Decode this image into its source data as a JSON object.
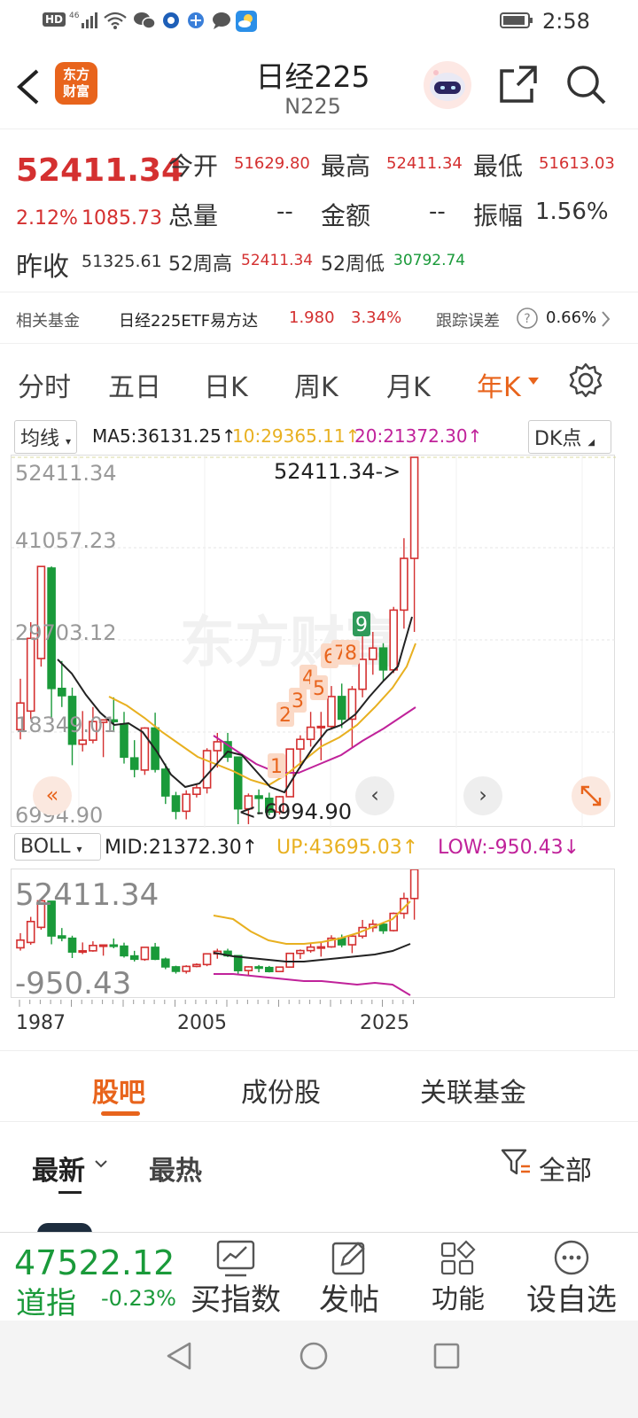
{
  "status": {
    "time": "2:58"
  },
  "header": {
    "title": "日经225",
    "code": "N225",
    "logo_line1": "东方",
    "logo_line2": "财富"
  },
  "quote": {
    "price": "52411.34",
    "change_pct": "2.12%",
    "change": "1085.73",
    "open_label": "今开",
    "open": "51629.80",
    "high_label": "最高",
    "high": "52411.34",
    "low_label": "最低",
    "low": "51613.03",
    "volume_label": "总量",
    "volume": "--",
    "amount_label": "金额",
    "amount": "--",
    "amplitude_label": "振幅",
    "amplitude": "1.56%",
    "prev_close_label": "昨收",
    "prev_close": "51325.61",
    "w52_high_label": "52周高",
    "w52_high": "52411.34",
    "w52_low_label": "52周低",
    "w52_low": "30792.74"
  },
  "fund": {
    "label": "相关基金",
    "name": "日经225ETF易方达",
    "price": "1.980",
    "pct": "3.34%",
    "err_label": "跟踪误差",
    "err": "0.66%"
  },
  "period_tabs": [
    "分时",
    "五日",
    "日K",
    "周K",
    "月K",
    "年K"
  ],
  "active_period": "年K",
  "ma_legend": {
    "selector": "均线",
    "ma5": "MA5:36131.25↑",
    "ma10": "10:29365.11↑",
    "ma20": "20:21372.30↑",
    "dk": "DK点"
  },
  "chart_labels": {
    "y_top": "52411.34",
    "y_2": "41057.23",
    "y_3": "29703.12",
    "y_4": "18349.01",
    "y_bottom": "6994.90",
    "high_marker": "52411.34->",
    "low_marker": "<-6994.90",
    "watermark": "东方财富"
  },
  "boll_legend": {
    "selector": "BOLL",
    "mid": "MID:21372.30↑",
    "up": "UP:43695.03↑",
    "low": "LOW:-950.43↓",
    "y_top": "52411.34",
    "y_bottom": "-950.43"
  },
  "x_axis": [
    "1987",
    "2005",
    "2025"
  ],
  "sub_tabs": [
    "股吧",
    "成份股",
    "关联基金"
  ],
  "sort_tabs": {
    "latest": "最新",
    "hot": "最热",
    "filter": "全部"
  },
  "bottom": {
    "index_value": "47522.12",
    "index_name": "道指",
    "index_pct": "-0.23%",
    "buy": "买指数",
    "post": "发帖",
    "func": "功能",
    "watch": "设自选"
  },
  "colors": {
    "up": "#d43030",
    "down": "#1a9a3a",
    "ma5": "#222222",
    "ma10": "#e8b020",
    "ma20": "#c0229a",
    "accent": "#e8641c"
  },
  "chart_data": {
    "type": "candlestick",
    "title": "",
    "x_labels": [
      "1987",
      "2005",
      "2025"
    ],
    "ylim": [
      6994.9,
      52411.34
    ],
    "tick_labels": [
      "52411.34",
      "41057.23",
      "29703.12",
      "18349.01",
      "6994.90"
    ],
    "candles": [
      {
        "o": 18700,
        "c": 22000,
        "h": 25000,
        "l": 17500
      },
      {
        "o": 21000,
        "c": 30000,
        "h": 32000,
        "l": 20000
      },
      {
        "o": 27500,
        "c": 38900,
        "h": 38900,
        "l": 26500
      },
      {
        "o": 38700,
        "c": 23800,
        "h": 38900,
        "l": 20200
      },
      {
        "o": 23800,
        "c": 22900,
        "h": 27200,
        "l": 21500
      },
      {
        "o": 22800,
        "c": 16900,
        "h": 23900,
        "l": 14300
      },
      {
        "o": 16900,
        "c": 17400,
        "h": 21000,
        "l": 16000
      },
      {
        "o": 17400,
        "c": 19700,
        "h": 21500,
        "l": 17000
      },
      {
        "o": 19600,
        "c": 19900,
        "h": 20000,
        "l": 15300
      },
      {
        "o": 19900,
        "c": 19700,
        "h": 22700,
        "l": 18500
      },
      {
        "o": 19400,
        "c": 15300,
        "h": 20900,
        "l": 14500
      },
      {
        "o": 15200,
        "c": 13800,
        "h": 17400,
        "l": 12800
      },
      {
        "o": 13700,
        "c": 18900,
        "h": 19000,
        "l": 13100
      },
      {
        "o": 18900,
        "c": 13800,
        "h": 20800,
        "l": 13400
      },
      {
        "o": 13800,
        "c": 10500,
        "h": 14500,
        "l": 9500
      },
      {
        "o": 10500,
        "c": 8600,
        "h": 11000,
        "l": 7600
      },
      {
        "o": 8600,
        "c": 10700,
        "h": 11200,
        "l": 7600
      },
      {
        "o": 10700,
        "c": 11500,
        "h": 12000,
        "l": 10300
      },
      {
        "o": 11500,
        "c": 16100,
        "h": 16400,
        "l": 10800
      },
      {
        "o": 16100,
        "c": 17200,
        "h": 18300,
        "l": 14000
      },
      {
        "o": 17200,
        "c": 15300,
        "h": 18300,
        "l": 14700
      },
      {
        "o": 15300,
        "c": 8900,
        "h": 15200,
        "l": 6994.9
      },
      {
        "o": 8900,
        "c": 10500,
        "h": 10800,
        "l": 7000
      },
      {
        "o": 10500,
        "c": 10200,
        "h": 11300,
        "l": 8200
      },
      {
        "o": 10200,
        "c": 8500,
        "h": 10900,
        "l": 8100
      },
      {
        "o": 8500,
        "c": 10400,
        "h": 10500,
        "l": 8200
      },
      {
        "o": 10400,
        "c": 16300,
        "h": 16300,
        "l": 10400
      },
      {
        "o": 16300,
        "c": 17500,
        "h": 18000,
        "l": 13900
      },
      {
        "o": 17500,
        "c": 19000,
        "h": 20900,
        "l": 16600
      },
      {
        "o": 19000,
        "c": 19100,
        "h": 20900,
        "l": 14900
      },
      {
        "o": 19100,
        "c": 22800,
        "h": 24100,
        "l": 18700
      },
      {
        "o": 22800,
        "c": 20000,
        "h": 24400,
        "l": 18900
      },
      {
        "o": 20000,
        "c": 23700,
        "h": 24100,
        "l": 16400
      },
      {
        "o": 23700,
        "c": 27400,
        "h": 30700,
        "l": 22700
      },
      {
        "o": 27400,
        "c": 28800,
        "h": 30800,
        "l": 25500
      },
      {
        "o": 28800,
        "c": 26100,
        "h": 29400,
        "l": 24700
      },
      {
        "o": 26100,
        "c": 33500,
        "h": 33900,
        "l": 25700
      },
      {
        "o": 33500,
        "c": 39900,
        "h": 42400,
        "l": 31200
      },
      {
        "o": 39900,
        "c": 52411.34,
        "h": 52411.34,
        "l": 30800
      }
    ],
    "annotations": [
      "1",
      "2",
      "3",
      "4",
      "5",
      "6",
      "7",
      "8",
      "9"
    ]
  }
}
